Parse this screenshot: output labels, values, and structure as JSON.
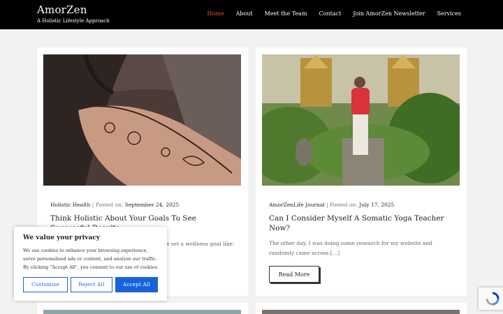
{
  "header": {
    "brand": "AmorZen",
    "tagline": "A Holistic Lifestyle Approach",
    "nav": [
      "Home",
      "About",
      "Meet the Team",
      "Contact",
      "Join AmorZen Newsletter",
      "Services"
    ],
    "active_nav": "Home",
    "accent_color": "#e8503a"
  },
  "posts": [
    {
      "category": "Holistic Health",
      "posted_label": "Posted on:",
      "date": "September 24, 2025",
      "title": "Think Holistic About Your Goals To See Successful Results",
      "excerpt_visible": "e set a wellness goal like:",
      "image_icon": "henna-hand-photo"
    },
    {
      "category": "AmorZenLife Journal",
      "posted_label": "Posted on:",
      "date": "July 17, 2025",
      "title": "Can I Consider Myself A Somatic Yoga Teacher Now?",
      "excerpt": "The other day, I was doing some research for my website and randomly came across […]",
      "read_more": "Read More",
      "image_icon": "temple-garden-photo"
    }
  ],
  "cookie": {
    "title": "We value your privacy",
    "text": "We use cookies to enhance your browsing experience, serve personalised ads or content, and analyse our traffic. By clicking \"Accept All\", you consent to our use of cookies.",
    "customise": "Customise",
    "reject": "Reject All",
    "accept": "Accept All",
    "button_color": "#1863dc"
  },
  "recaptcha_icon": "recaptcha-icon"
}
